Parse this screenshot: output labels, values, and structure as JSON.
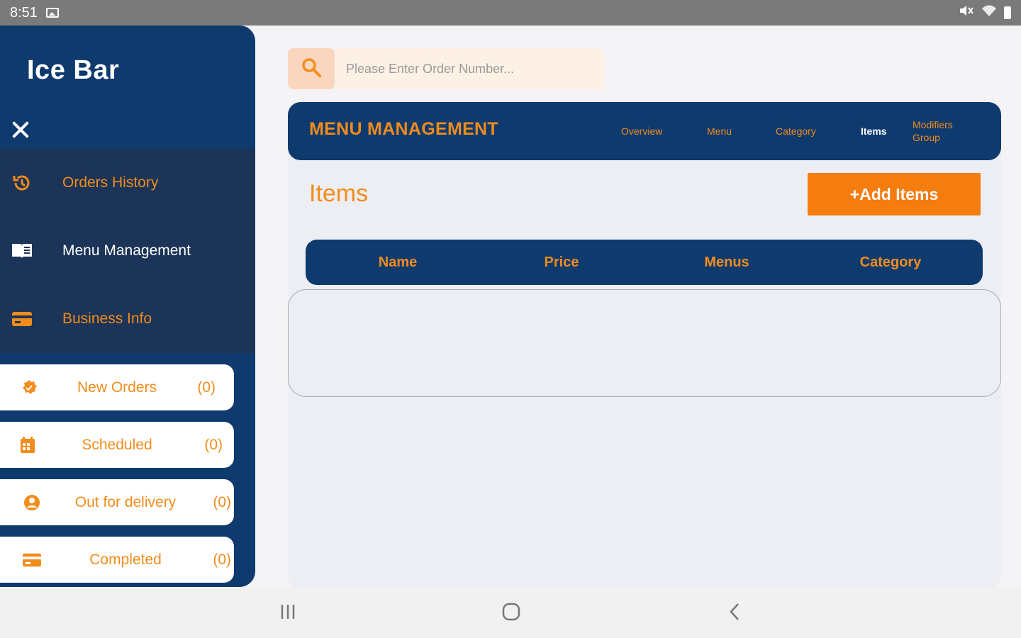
{
  "status_bar": {
    "time": "8:51"
  },
  "sidebar": {
    "brand": "Ice Bar",
    "nav_items": [
      {
        "label": "Orders History",
        "icon": "history-icon"
      },
      {
        "label": "Menu Management",
        "icon": "book-icon"
      },
      {
        "label": "Business Info",
        "icon": "card-icon"
      }
    ],
    "order_cards": [
      {
        "label": "New Orders",
        "count": "(0)",
        "icon": "new-badge-icon"
      },
      {
        "label": "Scheduled",
        "count": "(0)",
        "icon": "calendar-icon"
      },
      {
        "label": "Out for delivery",
        "count": "(0)",
        "icon": "person-icon"
      },
      {
        "label": "Completed",
        "count": "(0)",
        "icon": "card-icon"
      }
    ]
  },
  "search": {
    "placeholder": "Please Enter Order Number..."
  },
  "header": {
    "title": "MENU MANAGEMENT",
    "tabs": [
      {
        "label": "Overview"
      },
      {
        "label": "Menu"
      },
      {
        "label": "Category"
      },
      {
        "label": "Items"
      },
      {
        "label": "Modifiers Group"
      }
    ],
    "active_tab": "Items"
  },
  "page": {
    "title": "Items",
    "add_button": "+Add Items"
  },
  "table": {
    "columns": [
      "Name",
      "Price",
      "Menus",
      "Category"
    ],
    "rows": []
  },
  "colors": {
    "navy": "#0e3a6e",
    "nav_bg": "#1b3457",
    "orange": "#f28c1b",
    "button_orange": "#f57c0f"
  }
}
